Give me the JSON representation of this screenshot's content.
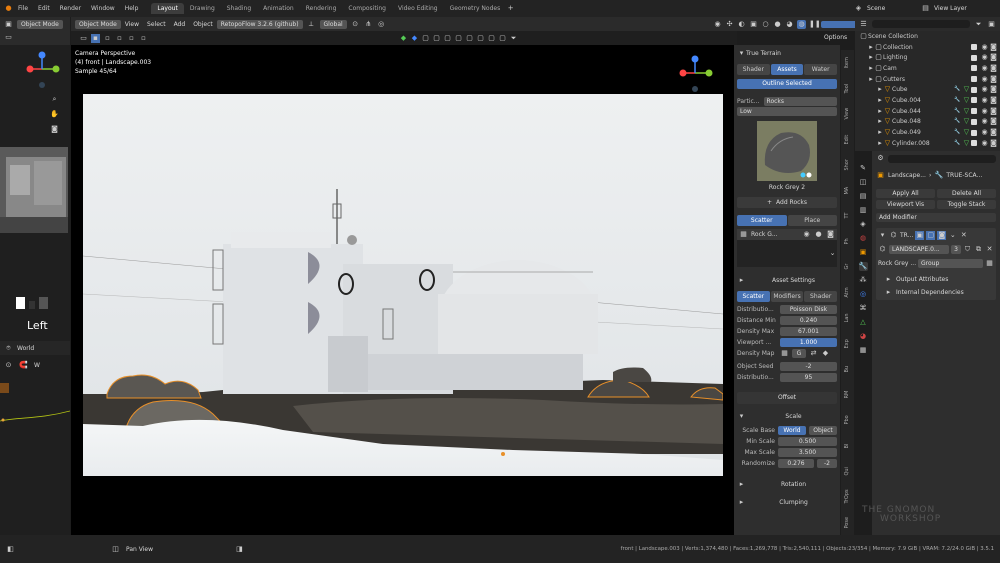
{
  "menu": [
    "File",
    "Edit",
    "Render",
    "Window",
    "Help"
  ],
  "workspaces": [
    {
      "label": "Layout",
      "active": true
    },
    {
      "label": "Drawing"
    },
    {
      "label": "Shading"
    },
    {
      "label": "Animation"
    },
    {
      "label": "Rendering"
    },
    {
      "label": "Compositing"
    },
    {
      "label": "Video Editing"
    },
    {
      "label": "Geometry Nodes"
    }
  ],
  "scene_name": "Scene",
  "view_layer": "View Layer",
  "left_editor": {
    "mode": "Object Mode",
    "view_label": "Left",
    "orientation": "World",
    "misc": "W"
  },
  "viewport_header": {
    "mode": "Object Mode",
    "menus": [
      "View",
      "Select",
      "Add",
      "Object"
    ],
    "addon": "RetopoFlow 3.2.6 (github)",
    "orientation": "Global",
    "options": "Options"
  },
  "viewport_overlay": {
    "line1": "Camera Perspective",
    "line2": "(4) front | Landscape.003",
    "line3": "Sample 45/64"
  },
  "true_terrain": {
    "title": "True Terrain",
    "tabs": [
      "Shader",
      "Assets",
      "Water"
    ],
    "active_tab": "Assets",
    "outline_btn": "Outline Selected",
    "particle_label": "Partic...",
    "particle_value": "Rocks",
    "quality": "Low",
    "asset_name": "Rock Grey 2",
    "add_btn": "Add Rocks",
    "scatter_tabs": [
      "Scatter",
      "Place"
    ],
    "list_item": "Rock G...",
    "asset_settings": "Asset Settings",
    "sub_tabs": [
      "Scatter",
      "Modifiers",
      "Shader"
    ],
    "props": [
      {
        "label": "Distributio...",
        "value": "Poisson Disk"
      },
      {
        "label": "Distance Min",
        "value": "0.240"
      },
      {
        "label": "Density Max",
        "value": "67.001"
      },
      {
        "label": "Viewport ...",
        "value": "1.000",
        "blue": true
      }
    ],
    "density_map": "Density Map",
    "density_map_value": "G",
    "seed_label": "Object Seed",
    "seed_value": "-2",
    "distrib_label": "Distributio...",
    "distrib_value": "95",
    "offset": "Offset",
    "scale": "Scale",
    "scale_base_label": "Scale Base",
    "scale_base_opts": [
      "World",
      "Object"
    ],
    "min_scale_label": "Min Scale",
    "min_scale": "0.500",
    "max_scale_label": "Max Scale",
    "max_scale": "3.500",
    "randomize_label": "Randomize",
    "randomize": "0.276",
    "randomize_seed": "-2",
    "rotation": "Rotation",
    "clumping": "Clumping"
  },
  "side_tabs": [
    "Item",
    "Tool",
    "View",
    "Edit",
    "Shor",
    "MA",
    "TT",
    "Ph",
    "Gr",
    "Atm",
    "Lan",
    "Exp",
    "Bu",
    "RM",
    "Pbo",
    "Bl",
    "Qui",
    "TrOps",
    "Pose"
  ],
  "outliner": {
    "root": "Scene Collection",
    "items": [
      {
        "label": "Collection",
        "indent": 1
      },
      {
        "label": "Lighting",
        "indent": 1
      },
      {
        "label": "Cam",
        "indent": 1
      },
      {
        "label": "Cutters",
        "indent": 1
      },
      {
        "label": "Cube",
        "indent": 2
      },
      {
        "label": "Cube.004",
        "indent": 2
      },
      {
        "label": "Cube.044",
        "indent": 2
      },
      {
        "label": "Cube.048",
        "indent": 2
      },
      {
        "label": "Cube.049",
        "indent": 2
      },
      {
        "label": "Cylinder.008",
        "indent": 2
      }
    ]
  },
  "properties": {
    "breadcrumb1": "Landscape...",
    "breadcrumb2": "TRUE-SCA...",
    "apply_all": "Apply All",
    "delete_all": "Delete All",
    "viewport_vis": "Viewport Vis",
    "toggle_stack": "Toggle Stack",
    "add_modifier": "Add Modifier",
    "modifier_short": "TR...",
    "modifier_name": "LANDSCAPE.0...",
    "modifier_count": "3",
    "input_label": "Rock Grey ...",
    "input_value": "Group",
    "output_attrs": "Output Attributes",
    "internal_deps": "Internal Dependencies"
  },
  "status_bar": {
    "hint": "Pan View",
    "stats": "front | Landscape.003 | Verts:1,374,480 | Faces:1,269,778 | Tris:2,540,111 | Objects:23/354 | Memory: 7.9 GiB | VRAM: 7.2/24.0 GiB | 3.5.1"
  },
  "watermark": {
    "line1": "THE GNOMON",
    "line2": "WORKSHOP"
  },
  "colors": {
    "accent": "#4772b3",
    "selection": "#f5a623",
    "panel": "#2e2e2e"
  }
}
